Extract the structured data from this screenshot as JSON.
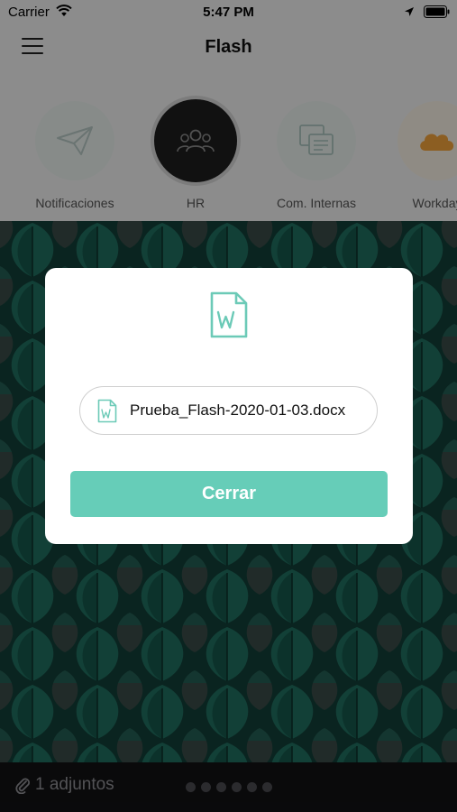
{
  "status_bar": {
    "carrier": "Carrier",
    "time": "5:47 PM"
  },
  "nav": {
    "title": "Flash",
    "menu_icon": "hamburger-menu-icon"
  },
  "categories": [
    {
      "label": "Notificaciones",
      "icon": "paper-plane-icon",
      "active": false
    },
    {
      "label": "HR",
      "icon": "people-group-icon",
      "active": true
    },
    {
      "label": "Com. Internas",
      "icon": "chat-document-icon",
      "active": false
    },
    {
      "label": "Workday",
      "icon": "cloud-icon",
      "active": false
    }
  ],
  "bottom_bar": {
    "attachments_label": "1 adjuntos",
    "attachment_icon": "paperclip-icon",
    "page_dots": 6
  },
  "modal": {
    "header_icon": "word-document-icon",
    "file_icon": "word-document-icon",
    "file_name": "Prueba_Flash-2020-01-03.docx",
    "close_label": "Cerrar"
  },
  "colors": {
    "accent": "#66cdb8",
    "icon_teal": "#6ccab7",
    "feed_bg": "#0f3a33",
    "active_circle": "#1e1e1e"
  }
}
